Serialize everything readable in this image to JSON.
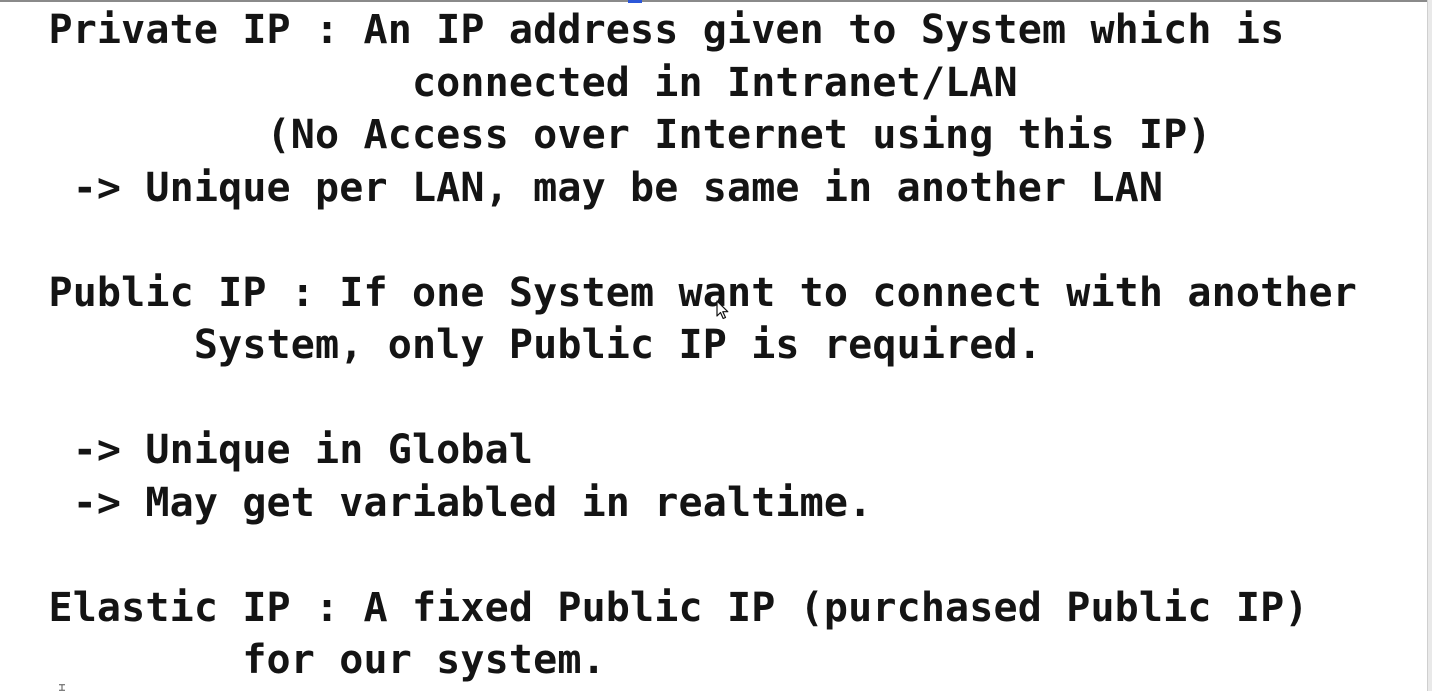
{
  "document": {
    "lines": [
      "  Private IP : An IP address given to System which is",
      "                 connected in Intranet/LAN",
      "           (No Access over Internet using this IP)",
      "   -> Unique per LAN, may be same in another LAN",
      "",
      "  Public IP : If one System want to connect with another",
      "        System, only Public IP is required.",
      "",
      "   -> Unique in Global",
      "   -> May get variabled in realtime.",
      "",
      "  Elastic IP : A fixed Public IP (purchased Public IP)",
      "          for our system."
    ]
  },
  "icons": {
    "mouse_pointer": "mouse-pointer-icon",
    "text_caret": "text-caret-icon"
  },
  "colors": {
    "text": "#141414",
    "background": "#ffffff",
    "marker": "#2b57d9"
  }
}
